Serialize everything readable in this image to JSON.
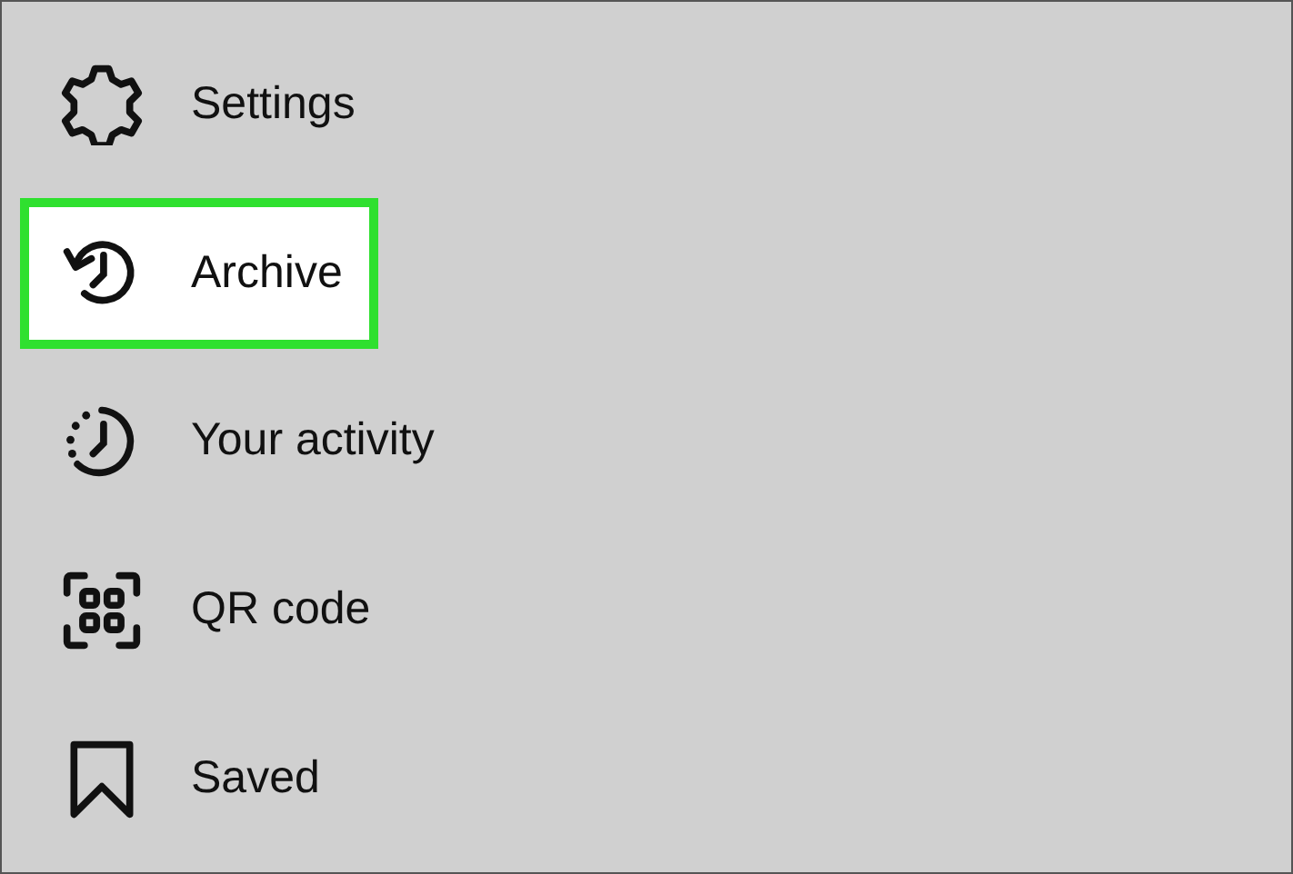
{
  "menu": {
    "items": [
      {
        "label": "Settings",
        "highlighted": false
      },
      {
        "label": "Archive",
        "highlighted": true
      },
      {
        "label": "Your activity",
        "highlighted": false
      },
      {
        "label": "QR code",
        "highlighted": false
      },
      {
        "label": "Saved",
        "highlighted": false
      }
    ]
  }
}
